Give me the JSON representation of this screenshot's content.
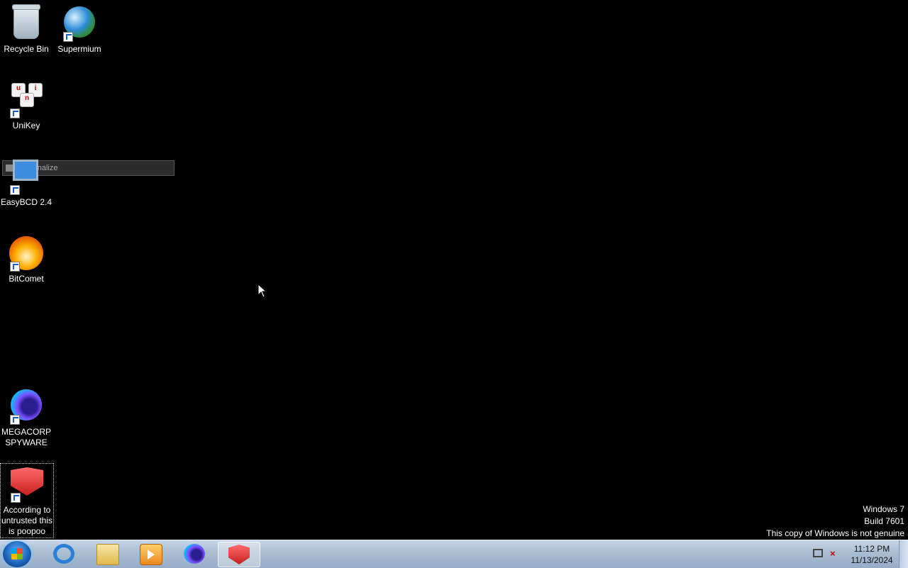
{
  "desktop": {
    "icons": [
      {
        "label": "Recycle Bin",
        "icon": "recycle-bin-icon"
      },
      {
        "label": "Supermium",
        "icon": "supermium-icon"
      },
      {
        "label": "UniKey",
        "icon": "unikey-icon"
      },
      {
        "label": "EasyBCD 2.4",
        "icon": "easybcd-icon"
      },
      {
        "label": "BitComet",
        "icon": "bitcomet-icon"
      },
      {
        "label": "MEGACORP SPYWARE",
        "icon": "firefox-icon"
      },
      {
        "label": "According to untrusted this is poopoo eater",
        "icon": "red-gem-icon"
      }
    ],
    "context_item": "Personalize",
    "unikey_keys": [
      "u",
      "i",
      "n"
    ]
  },
  "watermark": {
    "line1": "Windows 7",
    "line2": "Build 7601",
    "line3": "This copy of Windows is not genuine"
  },
  "taskbar": {
    "pinned": [
      "internet-explorer-icon",
      "file-explorer-icon",
      "media-player-icon",
      "firefox-icon",
      "red-gem-icon"
    ],
    "clock_time": "11:12 PM",
    "clock_date": "11/13/2024",
    "volume_glyph": "×"
  }
}
